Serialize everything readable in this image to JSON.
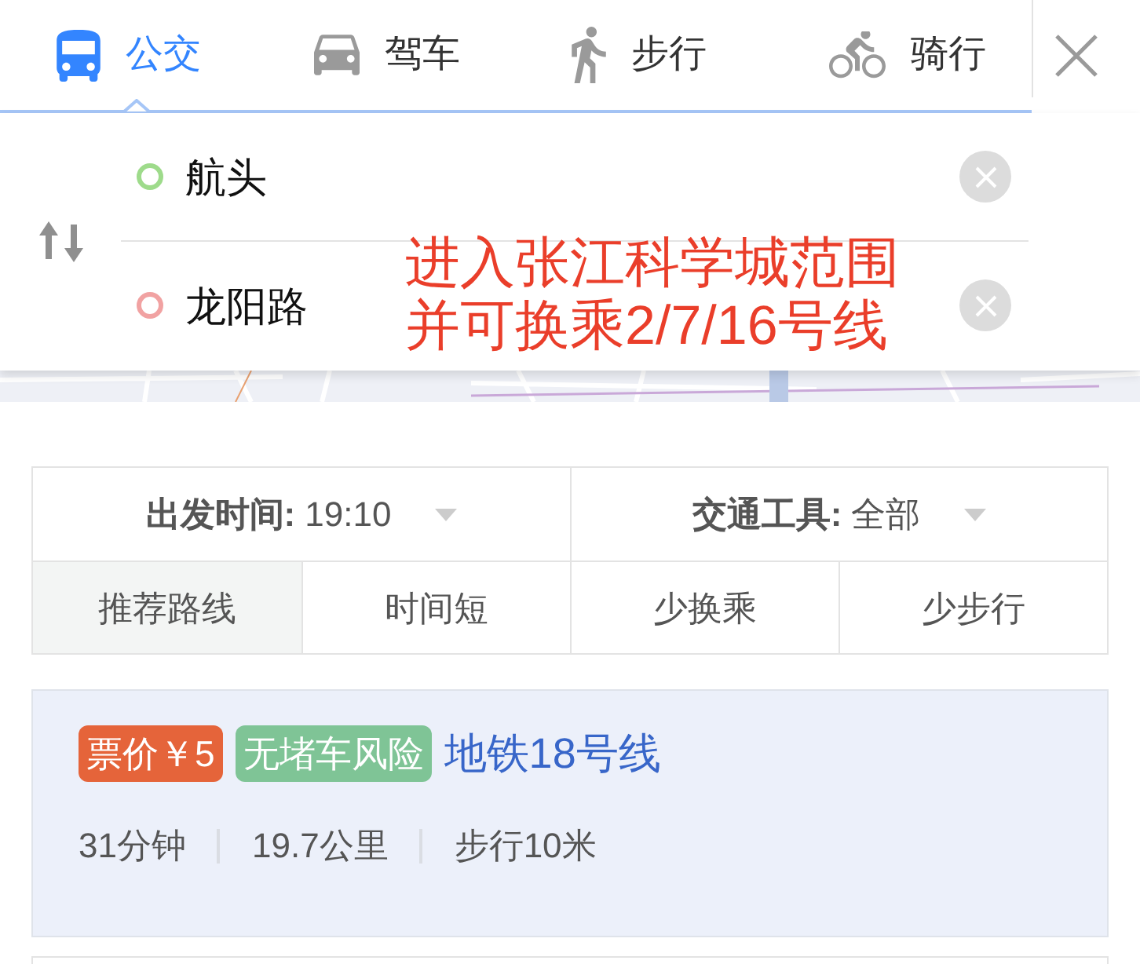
{
  "mode_tabs": [
    {
      "label": "公交",
      "kind": "bus",
      "selected": true
    },
    {
      "label": "驾车",
      "kind": "car",
      "selected": false
    },
    {
      "label": "步行",
      "kind": "walk",
      "selected": false
    },
    {
      "label": "骑行",
      "kind": "bike",
      "selected": false
    }
  ],
  "route_inputs": [
    {
      "value": "航头",
      "color": "#9edb8b"
    },
    {
      "value": "龙阳路",
      "color": "#f1a2a2"
    }
  ],
  "annotation": [
    "进入张江科学城范围",
    "并可换乘2/7/16号线"
  ],
  "filters": [
    {
      "label": "出发时间:",
      "value": "19:10"
    },
    {
      "label": "交通工具:",
      "value": "全部"
    }
  ],
  "sort_options": [
    {
      "label": "推荐路线",
      "selected": true
    },
    {
      "label": "时间短",
      "selected": false
    },
    {
      "label": "少换乘",
      "selected": false
    },
    {
      "label": "少步行",
      "selected": false
    }
  ],
  "route": {
    "tags": [
      {
        "text": "票价￥5",
        "color": "#e5643a"
      },
      {
        "text": "无堵车风险",
        "color": "#7fc496"
      }
    ],
    "title": "地铁18号线",
    "stats": [
      "31分钟",
      "19.7公里",
      "步行10米"
    ]
  }
}
